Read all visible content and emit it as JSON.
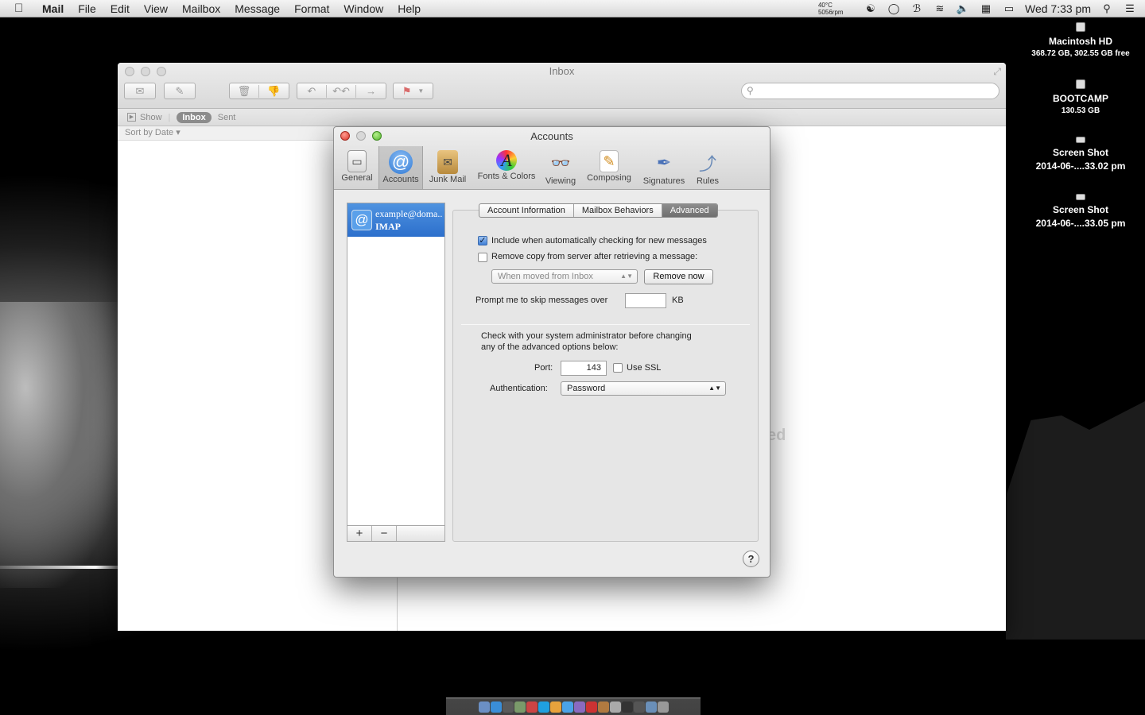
{
  "menubar": {
    "app": "Mail",
    "items": [
      "File",
      "Edit",
      "View",
      "Mailbox",
      "Message",
      "Format",
      "Window",
      "Help"
    ],
    "temp": "40°C",
    "rpm": "5056rpm",
    "clock": "Wed 7:33 pm"
  },
  "desktop": {
    "items": [
      {
        "name": "Macintosh HD",
        "sub": "368.72 GB, 302.55 GB free"
      },
      {
        "name": "BOOTCAMP",
        "sub": "130.53 GB"
      },
      {
        "name": "Screen Shot",
        "sub": "2014-06-....33.02 pm"
      },
      {
        "name": "Screen Shot",
        "sub": "2014-06-....33.05 pm"
      }
    ]
  },
  "mail": {
    "title": "Inbox",
    "favorites": {
      "show": "Show",
      "inbox": "Inbox",
      "sent": "Sent"
    },
    "sort": "Sort by Date ▾",
    "ghost": "ed"
  },
  "prefs": {
    "title": "Accounts",
    "tabs": [
      {
        "label": "General",
        "icon": "general-icon"
      },
      {
        "label": "Accounts",
        "icon": "at-sign-icon"
      },
      {
        "label": "Junk Mail",
        "icon": "junk-mail-icon"
      },
      {
        "label": "Fonts & Colors",
        "icon": "fonts-colors-icon"
      },
      {
        "label": "Viewing",
        "icon": "viewing-icon"
      },
      {
        "label": "Composing",
        "icon": "composing-icon"
      },
      {
        "label": "Signatures",
        "icon": "signatures-icon"
      },
      {
        "label": "Rules",
        "icon": "rules-icon"
      }
    ],
    "selected_tab": "Accounts",
    "account": {
      "email": "example@doma..",
      "type": "IMAP"
    },
    "add": "+",
    "remove": "−",
    "segments": [
      "Account Information",
      "Mailbox Behaviors",
      "Advanced"
    ],
    "selected_segment": "Advanced",
    "include_check": {
      "label": "Include when automatically checking for new messages",
      "checked": true
    },
    "remove_copy": {
      "label": "Remove copy from server after retrieving a message:",
      "checked": false
    },
    "when_moved": "When moved from Inbox",
    "remove_now": "Remove now",
    "prompt_skip": "Prompt me to skip messages over",
    "prompt_value": "",
    "kb": "KB",
    "admin_note_1": "Check with your system administrator before changing",
    "admin_note_2": "any of the advanced options below:",
    "port_label": "Port:",
    "port_value": "143",
    "ssl": {
      "label": "Use SSL",
      "checked": false
    },
    "auth_label": "Authentication:",
    "auth_value": "Password",
    "help": "?"
  }
}
